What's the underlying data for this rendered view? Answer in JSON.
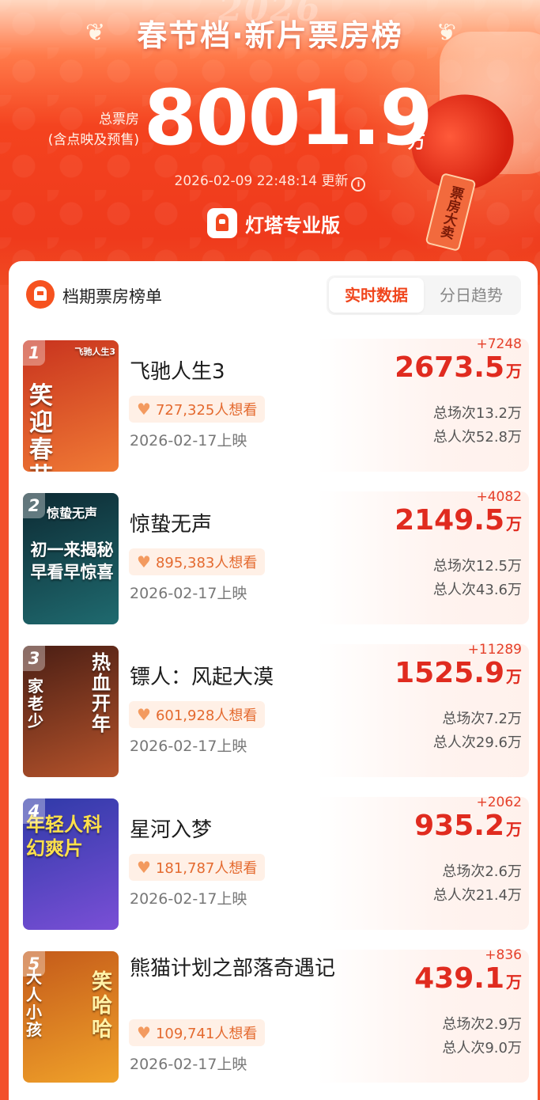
{
  "header": {
    "year_ghost": "2026",
    "title": "春节档·新片票房榜",
    "total_label_line1": "总票房",
    "total_label_line2": "(含点映及预售)",
    "total_value": "8001.9",
    "total_unit": "万",
    "update_time": "2026-02-09 22:48:14 更新",
    "brand": "灯塔专业版",
    "decor_tag": "票房大卖"
  },
  "board": {
    "title": "档期票房榜单",
    "tabs": [
      {
        "label": "实时数据",
        "active": true
      },
      {
        "label": "分日趋势",
        "active": false
      }
    ]
  },
  "movies": [
    {
      "rank": "1",
      "name": "飞驰人生3",
      "want": "727,325人想看",
      "release": "2026-02-17上映",
      "delta": "+7248",
      "gross": "2673.5",
      "unit": "万",
      "screenings": "总场次13.2万",
      "admissions": "总人次52.8万",
      "poster_text": "笑迎春节",
      "poster_corner": "飞驰人生3",
      "colors": {
        "bg1": "#c8331e",
        "bg2": "#f07a35"
      }
    },
    {
      "rank": "2",
      "name": "惊蛰无声",
      "want": "895,383人想看",
      "release": "2026-02-17上映",
      "delta": "+4082",
      "gross": "2149.5",
      "unit": "万",
      "screenings": "总场次12.5万",
      "admissions": "总人次43.6万",
      "poster_text": "初一来揭秘 早看早惊喜",
      "poster_corner": "惊蛰无声",
      "colors": {
        "bg1": "#0d2a33",
        "bg2": "#1f6a6f"
      }
    },
    {
      "rank": "3",
      "name": "镖人：风起大漠",
      "want": "601,928人想看",
      "release": "2026-02-17上映",
      "delta": "+11289",
      "gross": "1525.9",
      "unit": "万",
      "screenings": "总场次7.2万",
      "admissions": "总人次29.6万",
      "poster_text": "热血开年",
      "poster_corner": "家老少",
      "colors": {
        "bg1": "#4a1e14",
        "bg2": "#b5532b"
      }
    },
    {
      "rank": "4",
      "name": "星河入梦",
      "want": "181,787人想看",
      "release": "2026-02-17上映",
      "delta": "+2062",
      "gross": "935.2",
      "unit": "万",
      "screenings": "总场次2.6万",
      "admissions": "总人次21.4万",
      "poster_text": "年轻人科幻爽片",
      "poster_corner": "",
      "colors": {
        "bg1": "#2f3aa8",
        "bg2": "#7a4fd6"
      }
    },
    {
      "rank": "5",
      "name": "熊猫计划之部落奇遇记",
      "want": "109,741人想看",
      "release": "2026-02-17上映",
      "delta": "+836",
      "gross": "439.1",
      "unit": "万",
      "screenings": "总场次2.9万",
      "admissions": "总人次9.0万",
      "poster_text": "笑哈哈",
      "poster_corner": "大人小孩",
      "colors": {
        "bg1": "#c45a1a",
        "bg2": "#f0a22a"
      }
    }
  ]
}
